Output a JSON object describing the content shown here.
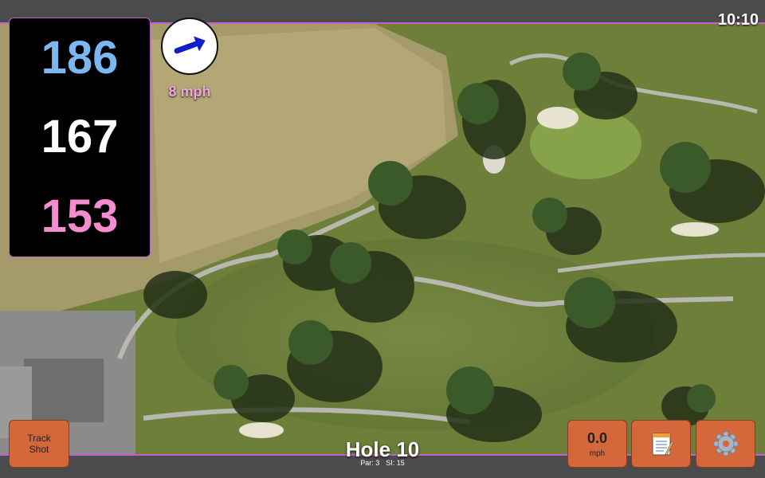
{
  "status_bar": {
    "time": "10:10"
  },
  "yardages": {
    "back": "186",
    "middle": "167",
    "front": "153"
  },
  "colors": {
    "back": "#7bb8f2",
    "middle": "#ffffff",
    "front": "#f48ccf",
    "button": "#d4683b",
    "accent": "#c55fd0"
  },
  "wind": {
    "speed_label": "8 mph",
    "arrow_icon": "wind-direction-arrow"
  },
  "buttons": {
    "track_shot_line1": "Track",
    "track_shot_line2": "Shot",
    "speed_value": "0.0",
    "speed_unit": "mph",
    "notes_icon": "notepad-icon",
    "settings_icon": "gear-icon"
  },
  "hole": {
    "title": "Hole 10",
    "par": "Par: 3",
    "si": "SI: 15"
  }
}
